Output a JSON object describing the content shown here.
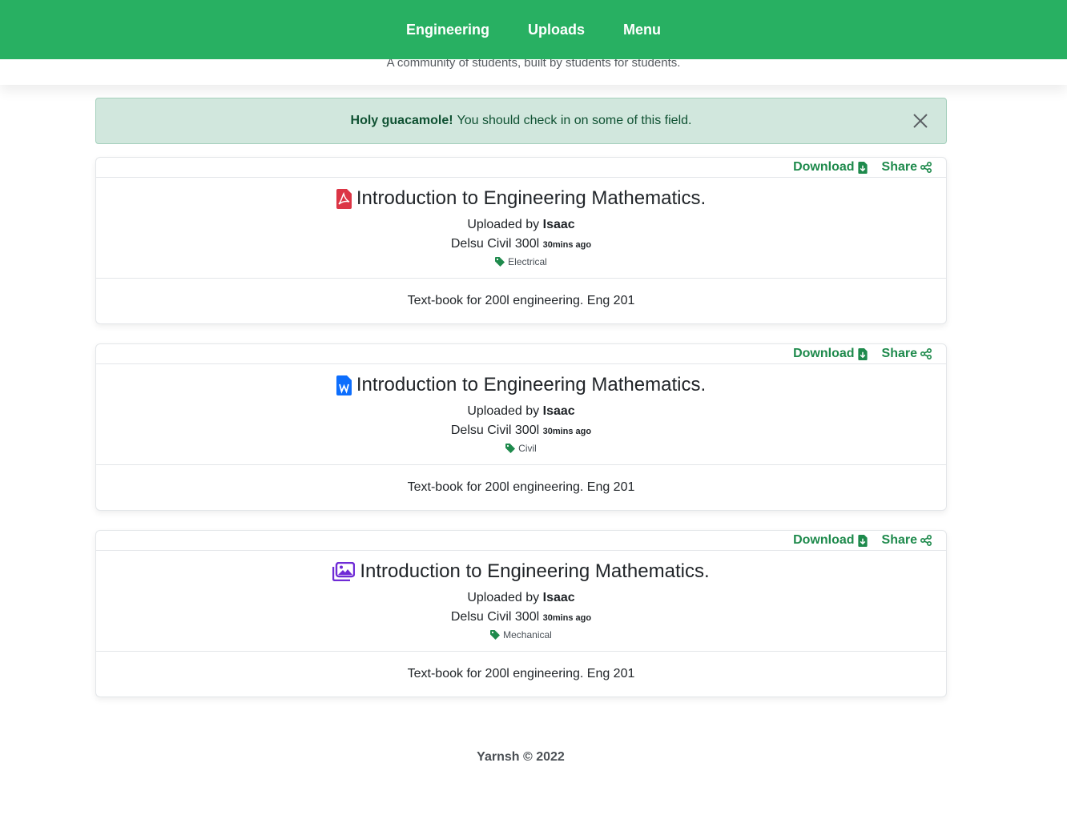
{
  "nav": {
    "items": [
      "Engineering",
      "Uploads",
      "Menu"
    ]
  },
  "hero": {
    "tagline": "A community of students, built by students for students."
  },
  "alert": {
    "strong": "Holy guacamole!",
    "message": "You should check in on some of this field."
  },
  "cards": [
    {
      "file_type": "pdf",
      "icon": "file-pdf-icon",
      "icon_color": "#dc3545",
      "download_label": "Download",
      "share_label": "Share",
      "title": "Introduction to Engineering Mathematics.",
      "uploaded_prefix": "Uploaded by",
      "uploader": "Isaac",
      "course": "Delsu Civil 300l",
      "time": "30mins ago",
      "tag": "Electrical",
      "description": "Text-book for 200l engineering. Eng 201"
    },
    {
      "file_type": "word",
      "icon": "file-word-icon",
      "icon_color": "#0d6efd",
      "download_label": "Download",
      "share_label": "Share",
      "title": "Introduction to Engineering Mathematics.",
      "uploaded_prefix": "Uploaded by",
      "uploader": "Isaac",
      "course": "Delsu Civil 300l",
      "time": "30mins ago",
      "tag": "Civil",
      "description": "Text-book for 200l engineering. Eng 201"
    },
    {
      "file_type": "images",
      "icon": "images-icon",
      "icon_color": "#6f2bd6",
      "download_label": "Download",
      "share_label": "Share",
      "title": "Introduction to Engineering Mathematics.",
      "uploaded_prefix": "Uploaded by",
      "uploader": "Isaac",
      "course": "Delsu Civil 300l",
      "time": "30mins ago",
      "tag": "Mechanical",
      "description": "Text-book for 200l engineering. Eng 201"
    }
  ],
  "footer": {
    "text": "Yarnsh © 2022"
  },
  "colors": {
    "brand": "#28b062",
    "link": "#1e8a4c",
    "alert_bg": "#d1e7dd"
  }
}
